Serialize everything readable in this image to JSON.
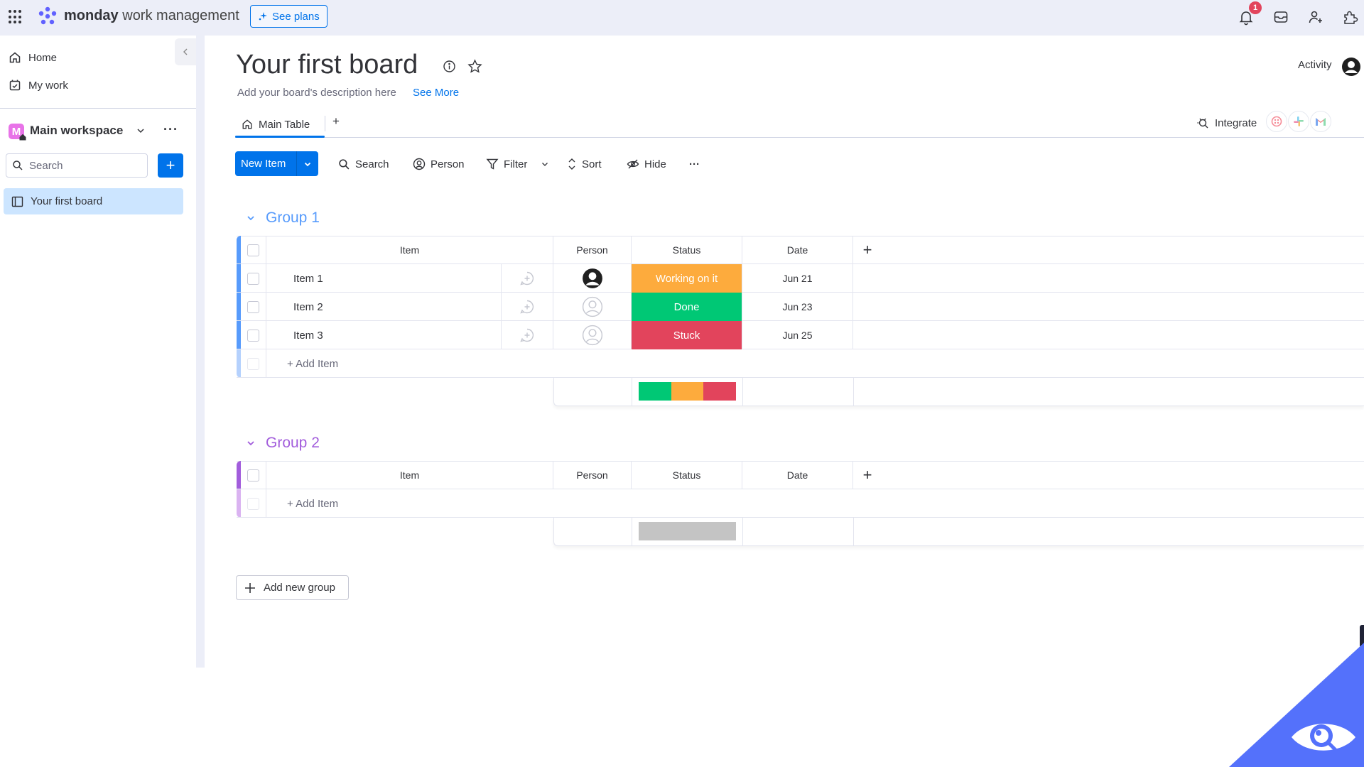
{
  "topbar": {
    "brand_bold": "monday",
    "brand_rest": " work management",
    "see_plans": "See plans",
    "notification_count": "1",
    "icons": [
      "apps-grid-icon",
      "monday-logo-icon",
      "bell-icon",
      "inbox-icon",
      "invite-member-icon",
      "apps-marketplace-icon"
    ]
  },
  "sidebar": {
    "collapse_icon": "chevron-left-icon",
    "nav": [
      {
        "label": "Home",
        "icon": "home-icon"
      },
      {
        "label": "My work",
        "icon": "calendar-check-icon"
      }
    ],
    "workspace": {
      "avatar_letter": "M",
      "name": "Main workspace"
    },
    "search_placeholder": "Search",
    "add_label": "+",
    "boards": [
      {
        "label": "Your first board",
        "icon": "board-icon",
        "selected": true
      }
    ]
  },
  "board": {
    "title": "Your first board",
    "description": "Add your board's description here",
    "see_more": "See More",
    "activity_label": "Activity",
    "tabs": [
      {
        "label": "Main Table",
        "icon": "home-icon",
        "active": true
      }
    ],
    "add_tab": "+",
    "integrate_label": "Integrate",
    "integrations": [
      "twilio-icon",
      "slack-icon",
      "gmail-icon"
    ]
  },
  "toolbar": {
    "new_item": "New Item",
    "search": "Search",
    "person": "Person",
    "filter": "Filter",
    "sort": "Sort",
    "hide": "Hide",
    "more": "···"
  },
  "columns": {
    "item": "Item",
    "person": "Person",
    "status": "Status",
    "date": "Date",
    "add": "+"
  },
  "groups": [
    {
      "title": "Group 1",
      "color": "#579bfc",
      "items": [
        {
          "name": "Item 1",
          "person": "assigned",
          "status": "Working on it",
          "status_color": "#fdab3d",
          "date": "Jun 21"
        },
        {
          "name": "Item 2",
          "person": "empty",
          "status": "Done",
          "status_color": "#00c875",
          "date": "Jun 23"
        },
        {
          "name": "Item 3",
          "person": "empty",
          "status": "Stuck",
          "status_color": "#e2445c",
          "date": "Jun 25"
        }
      ],
      "add_item": "+ Add Item",
      "status_summary": [
        {
          "label": "Done",
          "color": "#00c875",
          "fraction": 0.3333
        },
        {
          "label": "Working on it",
          "color": "#fdab3d",
          "fraction": 0.3333
        },
        {
          "label": "Stuck",
          "color": "#e2445c",
          "fraction": 0.3334
        }
      ]
    },
    {
      "title": "Group 2",
      "color": "#a25ddc",
      "items": [],
      "add_item": "+ Add Item",
      "status_summary": [
        {
          "label": "Empty",
          "color": "#c4c4c4",
          "fraction": 1.0
        }
      ]
    }
  ],
  "add_new_group": "Add new group"
}
